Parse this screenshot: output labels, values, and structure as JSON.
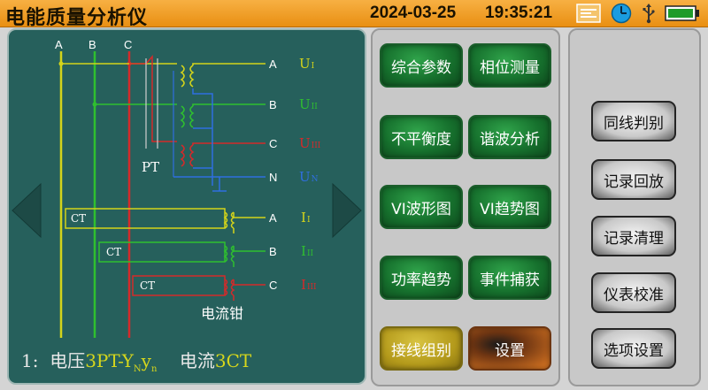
{
  "header": {
    "title": "电能质量分析仪",
    "date": "2024-03-25",
    "time": "19:35:21"
  },
  "status_icons": [
    "keyboard-icon",
    "clock-icon",
    "usb-icon",
    "battery-icon"
  ],
  "diagram": {
    "bus_labels": [
      "A",
      "B",
      "C"
    ],
    "pt_label": "PT",
    "ct_labels": [
      "CT",
      "CT",
      "CT"
    ],
    "clamp_label": "电流钳",
    "voltage_terminals": [
      "A",
      "B",
      "C",
      "N"
    ],
    "current_terminals": [
      "A",
      "B",
      "C"
    ],
    "voltage_symbols": [
      {
        "main": "U",
        "sub": "I"
      },
      {
        "main": "U",
        "sub": "II"
      },
      {
        "main": "U",
        "sub": "III"
      },
      {
        "main": "U",
        "sub": "N"
      }
    ],
    "current_symbols": [
      {
        "main": "I",
        "sub": "I"
      },
      {
        "main": "I",
        "sub": "II"
      },
      {
        "main": "I",
        "sub": "III"
      }
    ],
    "colors": {
      "phase_a": "#d4d41a",
      "phase_b": "#2fbf2f",
      "phase_c": "#d42a2a",
      "neutral": "#2f6fe0",
      "panel": "#26605c"
    }
  },
  "wiring_status": {
    "index": "1:",
    "voltage_prefix": "电压",
    "voltage_mode": "3PT-Y",
    "voltage_sub1": "N",
    "voltage_mid": "y",
    "voltage_sub2": "n",
    "current_prefix": "电流",
    "current_mode": "3CT"
  },
  "menu": {
    "comprehensive": "综合参数",
    "phase": "相位测量",
    "unbalance": "不平衡度",
    "harmonic": "谐波分析",
    "vi_wave": "VI波形图",
    "vi_trend": "VI趋势图",
    "power_trend": "功率趋势",
    "event": "事件捕获",
    "wiring_group": "接线组别",
    "settings": "设置"
  },
  "side_menu": {
    "same_line": "同线判别",
    "replay": "记录回放",
    "clear": "记录清理",
    "calibrate": "仪表校准",
    "options": "选项设置"
  }
}
